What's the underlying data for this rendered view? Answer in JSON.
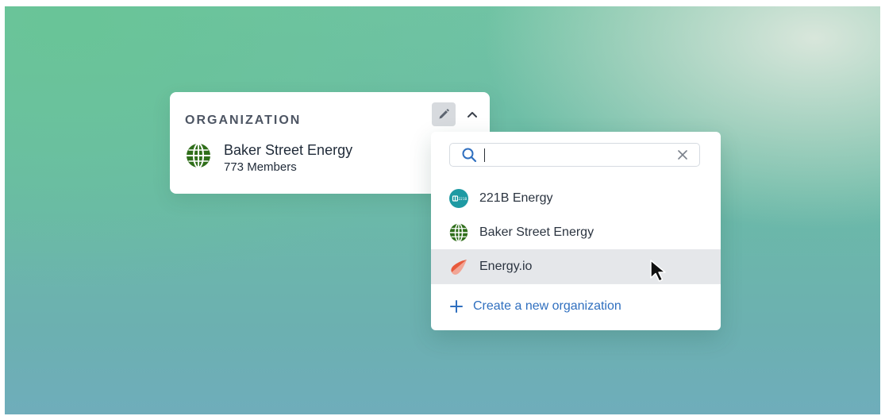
{
  "colors": {
    "accent": "#2f6fbf",
    "hover_row": "#e5e7ea",
    "edit_button_bg": "#d7dade",
    "globe_green": "#2f6e1a",
    "teal_logo": "#1e9aa3",
    "energyio_logo": "#e85a3c"
  },
  "org_card": {
    "header": "ORGANIZATION",
    "edit_icon": "pencil-icon",
    "collapse_icon": "chevron-up-icon",
    "selected": {
      "name": "Baker Street Energy",
      "members": "773 Members",
      "logo_icon": "globe-icon"
    }
  },
  "dropdown": {
    "search": {
      "value": "",
      "placeholder": "",
      "icon": "search-icon",
      "clear_icon": "close-icon"
    },
    "options": [
      {
        "label": "221B Energy",
        "icon": "221b-logo-icon",
        "hovered": false
      },
      {
        "label": "Baker Street Energy",
        "icon": "globe-icon",
        "hovered": false
      },
      {
        "label": "Energy.io",
        "icon": "energyio-logo-icon",
        "hovered": true
      }
    ],
    "create": {
      "label": "Create a new organization",
      "icon": "plus-icon"
    },
    "logo_221b_text": "221B"
  }
}
